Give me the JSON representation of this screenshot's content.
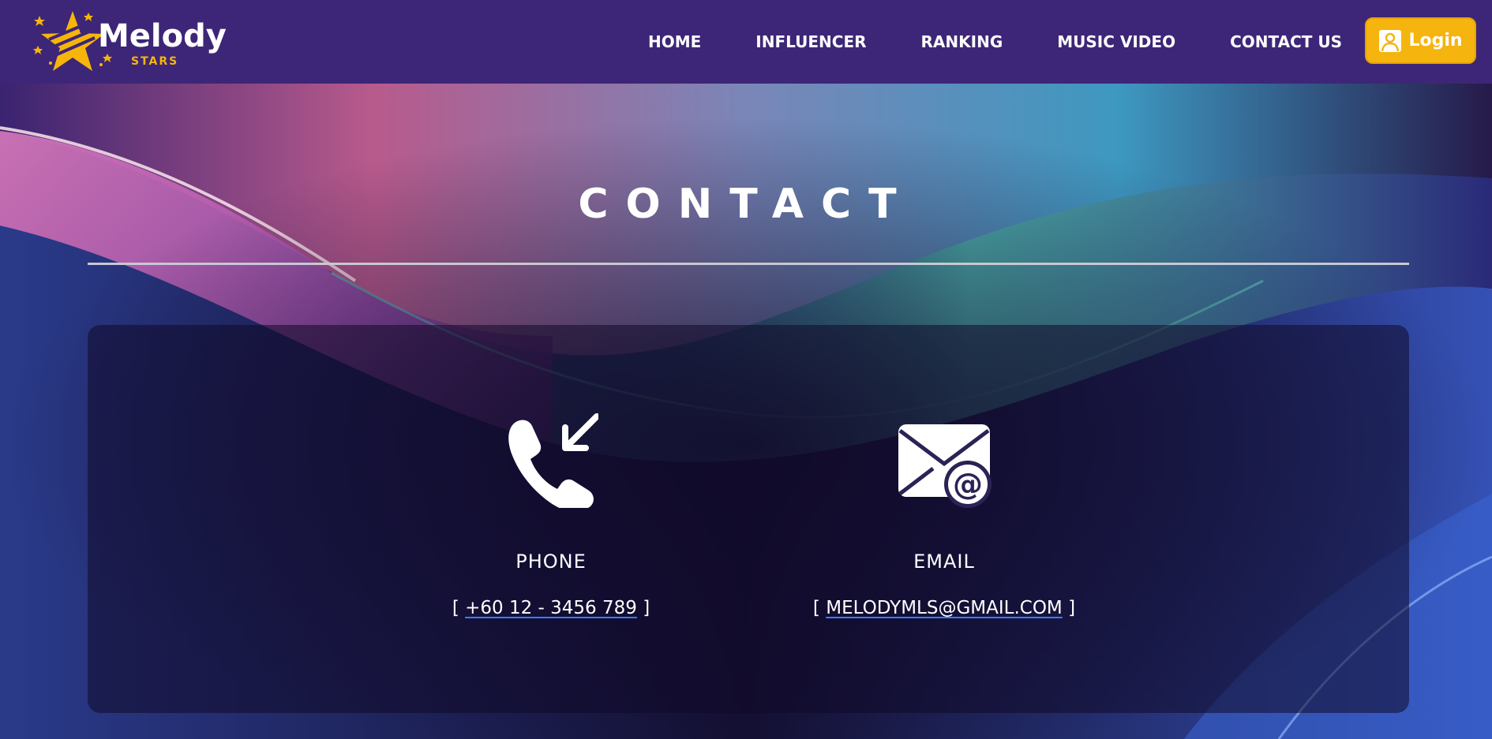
{
  "brand": {
    "name": "Melody",
    "tagline": "STARS",
    "accent_color": "#f5b40e",
    "header_color": "#3d2677"
  },
  "nav": {
    "items": [
      {
        "label": "HOME"
      },
      {
        "label": "INFLUENCER"
      },
      {
        "label": "RANKING"
      },
      {
        "label": "MUSIC VIDEO"
      },
      {
        "label": "CONTACT US"
      }
    ],
    "login_label": "Login",
    "login_icon": "user-icon"
  },
  "main": {
    "title": "CONTACT",
    "contacts": [
      {
        "icon": "phone-incoming-icon",
        "label": "PHONE",
        "open_bracket": "[",
        "value": "+60 12 - 3456 789",
        "close_bracket": "]"
      },
      {
        "icon": "email-at-icon",
        "label": "EMAIL",
        "open_bracket": "[",
        "value": "MELODYMLS@GMAIL.COM",
        "close_bracket": "]"
      }
    ]
  }
}
